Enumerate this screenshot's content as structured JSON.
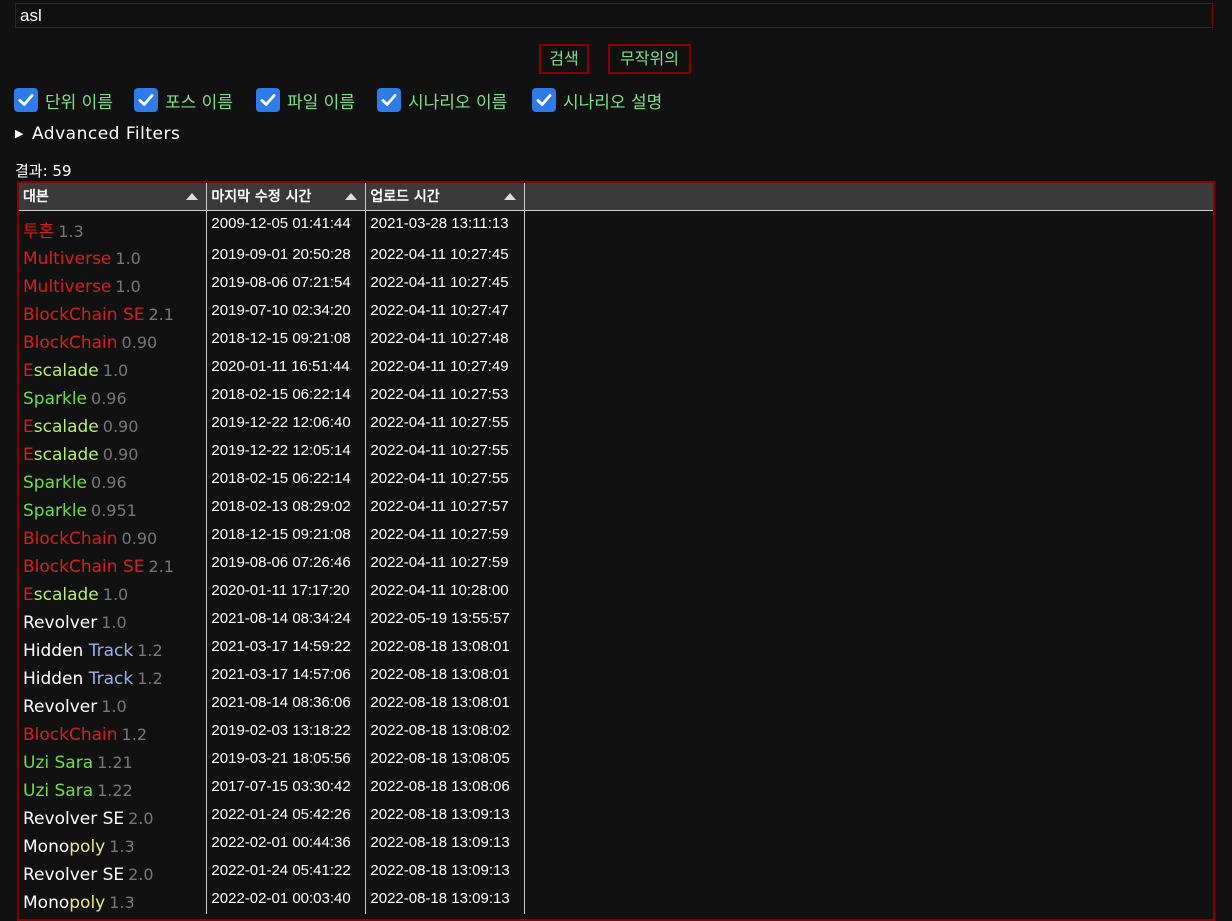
{
  "search": {
    "value": "asl"
  },
  "buttons": {
    "search": "검색",
    "random": "무작위의"
  },
  "filters": [
    {
      "label": "단위 이름",
      "checked": true
    },
    {
      "label": "포스 이름",
      "checked": true
    },
    {
      "label": "파일 이름",
      "checked": true
    },
    {
      "label": "시나리오 이름",
      "checked": true
    },
    {
      "label": "시나리오 설명",
      "checked": true
    }
  ],
  "advanced": {
    "label": "Advanced Filters"
  },
  "result": {
    "text": "결과: 59"
  },
  "table": {
    "headers": [
      "대본",
      "마지막 수정 시간",
      "업로드 시간"
    ],
    "rows": [
      {
        "parts": [
          {
            "t": "투혼",
            "c": "red"
          }
        ],
        "ver": "1.3",
        "modified": "2009-12-05 01:41:44",
        "uploaded": "2021-03-28 13:11:13"
      },
      {
        "parts": [
          {
            "t": "Multiverse",
            "c": "red"
          }
        ],
        "ver": "1.0",
        "modified": "2019-09-01 20:50:28",
        "uploaded": "2022-04-11 10:27:45"
      },
      {
        "parts": [
          {
            "t": "Multiverse",
            "c": "red"
          }
        ],
        "ver": "1.0",
        "modified": "2019-08-06 07:21:54",
        "uploaded": "2022-04-11 10:27:45"
      },
      {
        "parts": [
          {
            "t": "BlockChain SE",
            "c": "red"
          }
        ],
        "ver": "2.1",
        "modified": "2019-07-10 02:34:20",
        "uploaded": "2022-04-11 10:27:47"
      },
      {
        "parts": [
          {
            "t": "BlockChain",
            "c": "red"
          }
        ],
        "ver": "0.90",
        "modified": "2018-12-15 09:21:08",
        "uploaded": "2022-04-11 10:27:48"
      },
      {
        "parts": [
          {
            "t": "E",
            "c": "red"
          },
          {
            "t": "scalade",
            "c": "lightgreen"
          }
        ],
        "ver": "1.0",
        "modified": "2020-01-11 16:51:44",
        "uploaded": "2022-04-11 10:27:49"
      },
      {
        "parts": [
          {
            "t": "Sparkle",
            "c": "green"
          }
        ],
        "ver": "0.96",
        "modified": "2018-02-15 06:22:14",
        "uploaded": "2022-04-11 10:27:53"
      },
      {
        "parts": [
          {
            "t": "E",
            "c": "red"
          },
          {
            "t": "scalade",
            "c": "lightgreen"
          }
        ],
        "ver": "0.90",
        "modified": "2019-12-22 12:06:40",
        "uploaded": "2022-04-11 10:27:55"
      },
      {
        "parts": [
          {
            "t": "E",
            "c": "red"
          },
          {
            "t": "scalade",
            "c": "lightgreen"
          }
        ],
        "ver": "0.90",
        "modified": "2019-12-22 12:05:14",
        "uploaded": "2022-04-11 10:27:55"
      },
      {
        "parts": [
          {
            "t": "Sparkle",
            "c": "green"
          }
        ],
        "ver": "0.96",
        "modified": "2018-02-15 06:22:14",
        "uploaded": "2022-04-11 10:27:55"
      },
      {
        "parts": [
          {
            "t": "Sparkle",
            "c": "green"
          }
        ],
        "ver": "0.951",
        "modified": "2018-02-13 08:29:02",
        "uploaded": "2022-04-11 10:27:57"
      },
      {
        "parts": [
          {
            "t": "BlockChain",
            "c": "red"
          }
        ],
        "ver": "0.90",
        "modified": "2018-12-15 09:21:08",
        "uploaded": "2022-04-11 10:27:59"
      },
      {
        "parts": [
          {
            "t": "BlockChain SE",
            "c": "red"
          }
        ],
        "ver": "2.1",
        "modified": "2019-08-06 07:26:46",
        "uploaded": "2022-04-11 10:27:59"
      },
      {
        "parts": [
          {
            "t": "E",
            "c": "red"
          },
          {
            "t": "scalade",
            "c": "lightgreen"
          }
        ],
        "ver": "1.0",
        "modified": "2020-01-11 17:17:20",
        "uploaded": "2022-04-11 10:28:00"
      },
      {
        "parts": [
          {
            "t": "Revolver",
            "c": "white"
          }
        ],
        "ver": "1.0",
        "modified": "2021-08-14 08:34:24",
        "uploaded": "2022-05-19 13:55:57"
      },
      {
        "parts": [
          {
            "t": "Hidden ",
            "c": "white"
          },
          {
            "t": "Track",
            "c": "blue"
          }
        ],
        "ver": "1.2",
        "modified": "2021-03-17 14:59:22",
        "uploaded": "2022-08-18 13:08:01"
      },
      {
        "parts": [
          {
            "t": "Hidden ",
            "c": "white"
          },
          {
            "t": "Track",
            "c": "blue"
          }
        ],
        "ver": "1.2",
        "modified": "2021-03-17 14:57:06",
        "uploaded": "2022-08-18 13:08:01"
      },
      {
        "parts": [
          {
            "t": "Revolver",
            "c": "white"
          }
        ],
        "ver": "1.0",
        "modified": "2021-08-14 08:36:06",
        "uploaded": "2022-08-18 13:08:01"
      },
      {
        "parts": [
          {
            "t": "BlockChain",
            "c": "red"
          }
        ],
        "ver": "1.2",
        "modified": "2019-02-03 13:18:22",
        "uploaded": "2022-08-18 13:08:02"
      },
      {
        "parts": [
          {
            "t": "Uzi Sara",
            "c": "green"
          }
        ],
        "ver": "1.21",
        "modified": "2019-03-21 18:05:56",
        "uploaded": "2022-08-18 13:08:05"
      },
      {
        "parts": [
          {
            "t": "Uzi Sara",
            "c": "green"
          }
        ],
        "ver": "1.22",
        "modified": "2017-07-15 03:30:42",
        "uploaded": "2022-08-18 13:08:06"
      },
      {
        "parts": [
          {
            "t": "Revolver SE",
            "c": "white"
          }
        ],
        "ver": "2.0",
        "modified": "2022-01-24 05:42:26",
        "uploaded": "2022-08-18 13:09:13"
      },
      {
        "parts": [
          {
            "t": "Mono",
            "c": "white"
          },
          {
            "t": "poly",
            "c": "yellow"
          }
        ],
        "ver": "1.3",
        "modified": "2022-02-01 00:44:36",
        "uploaded": "2022-08-18 13:09:13"
      },
      {
        "parts": [
          {
            "t": "Revolver SE",
            "c": "white"
          }
        ],
        "ver": "2.0",
        "modified": "2022-01-24 05:41:22",
        "uploaded": "2022-08-18 13:09:13"
      },
      {
        "parts": [
          {
            "t": "Mono",
            "c": "white"
          },
          {
            "t": "poly",
            "c": "yellow"
          }
        ],
        "ver": "1.3",
        "modified": "2022-02-01 00:03:40",
        "uploaded": "2022-08-18 13:09:13"
      }
    ]
  }
}
